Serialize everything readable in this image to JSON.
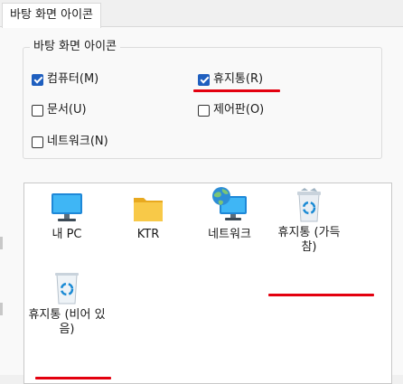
{
  "tab": {
    "label": "바탕 화면 아이콘"
  },
  "group": {
    "title": "바탕 화면 아이콘",
    "checkboxes": [
      {
        "label": "컴퓨터(M)",
        "checked": true
      },
      {
        "label": "휴지통(R)",
        "checked": true
      },
      {
        "label": "문서(U)",
        "checked": false
      },
      {
        "label": "제어판(O)",
        "checked": false
      },
      {
        "label": "네트워크(N)",
        "checked": false
      }
    ]
  },
  "icons": [
    {
      "label": "내 PC",
      "icon": "monitor-icon"
    },
    {
      "label": "KTR",
      "icon": "folder-icon"
    },
    {
      "label": "네트워크",
      "icon": "network-globe-icon"
    },
    {
      "label": "휴지통 (가득 참)",
      "icon": "recycle-bin-full-icon"
    },
    {
      "label": "휴지통 (비어 있음)",
      "icon": "recycle-bin-empty-icon"
    }
  ],
  "colors": {
    "accent": "#1f5fbf",
    "annotation_underline": "#e3000f",
    "folder": "#f8c948",
    "monitor": "#1aa0e8"
  }
}
